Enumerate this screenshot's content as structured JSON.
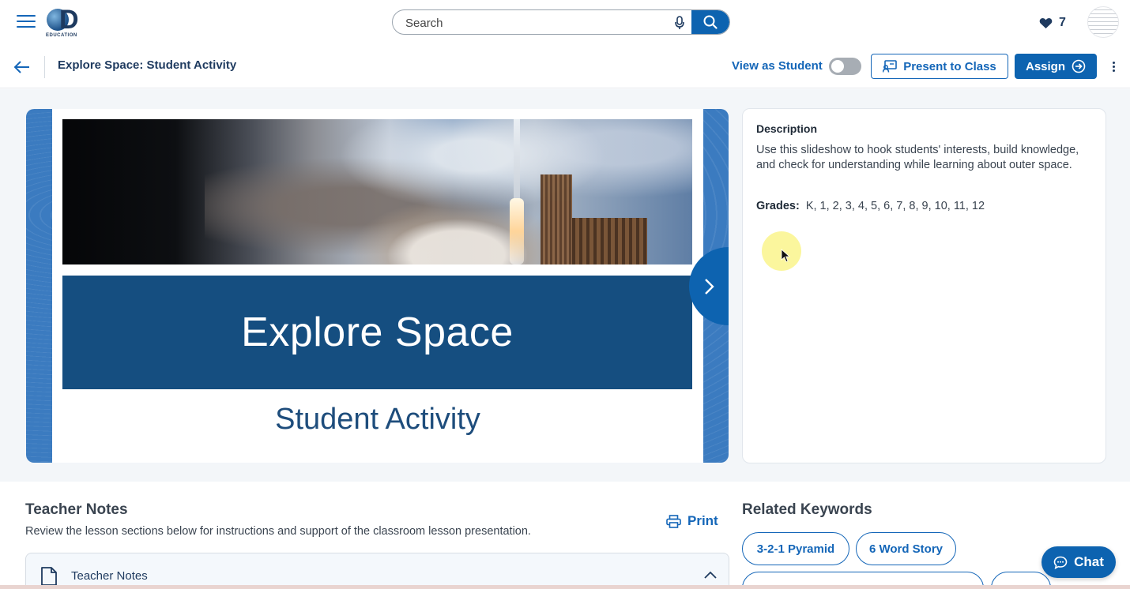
{
  "header": {
    "logo_text": "EDUCATION",
    "search_placeholder": "Search",
    "favorites_count": "7"
  },
  "titlebar": {
    "title": "Explore Space: Student Activity",
    "view_as_student": "View as Student",
    "view_as_student_on": false,
    "present_label": "Present to Class",
    "assign_label": "Assign"
  },
  "preview": {
    "slide_title": "Explore Space",
    "slide_subtitle": "Student Activity"
  },
  "description": {
    "heading": "Description",
    "text": "Use this slideshow to hook students' interests, build knowledge, and check for understanding while learning about outer space.",
    "grades_label": "Grades:",
    "grades_value": "K, 1, 2, 3, 4, 5, 6, 7, 8, 9, 10, 11, 12"
  },
  "teacher_notes": {
    "title": "Teacher Notes",
    "description": "Review the lesson sections below for instructions and support of the classroom lesson presentation.",
    "print_label": "Print",
    "accordion_label": "Teacher Notes"
  },
  "related_keywords": {
    "title": "Related Keywords",
    "chips": [
      "3-2-1 Pyramid",
      "6 Word Story"
    ]
  },
  "chat": {
    "label": "Chat"
  },
  "colors": {
    "primary": "#0d63b0",
    "navy": "#1e3a5f",
    "banner": "#154e80"
  }
}
